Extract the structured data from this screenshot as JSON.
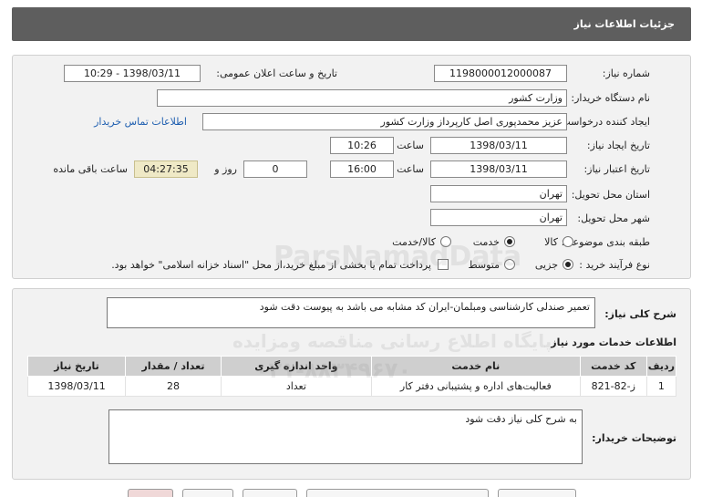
{
  "header": {
    "title": "جزئیات اطلاعات نیاز"
  },
  "form": {
    "need_number_label": "شماره نیاز:",
    "need_number": "1198000012000087",
    "announce_label": "تاریخ و ساعت اعلان عمومی:",
    "announce_value": "1398/03/11 - 10:29",
    "buyer_org_label": "نام دستگاه خریدار:",
    "buyer_org": "وزارت کشور",
    "creator_label": "ایجاد کننده درخواست:",
    "creator": "عزیز محمدپوری اصل کارپرداز وزارت کشور",
    "contact_link": "اطلاعات تماس خریدار",
    "created_date_label": "تاریخ ایجاد نیاز:",
    "created_date": "1398/03/11",
    "hour_label": "ساعت",
    "created_time": "10:26",
    "validity_label": "تاریخ اعتبار نیاز:",
    "validity_date": "1398/03/11",
    "validity_time": "16:00",
    "days_value": "0",
    "days_label": "روز و",
    "remaining_time": "04:27:35",
    "remaining_label": "ساعت باقی مانده",
    "province_label": "استان محل تحویل:",
    "province": "تهران",
    "city_label": "شهر محل تحویل:",
    "city": "تهران",
    "category_label": "طبقه بندی موضوعی:",
    "category_options": [
      "کالا",
      "خدمت",
      "کالا/خدمت"
    ],
    "process_label": "نوع فرآیند خرید :",
    "process_options": [
      "جزیی",
      "متوسط"
    ],
    "payment_note": "پرداخت تمام یا بخشی از مبلغ خرید،از محل \"اسناد خزانه اسلامی\" خواهد بود."
  },
  "summary": {
    "label": "شرح کلی نیاز:",
    "text": "تعمیر صندلی کارشناسی ومبلمان-ایران کد مشابه می باشد به پیوست دقت شود"
  },
  "services": {
    "title": "اطلاعات خدمات مورد نیاز",
    "columns": [
      "ردیف",
      "کد خدمت",
      "نام خدمت",
      "واحد اندازه گیری",
      "تعداد / مقدار",
      "تاریخ نیاز"
    ],
    "rows": [
      [
        "1",
        "ز-82-821",
        "فعالیت‌های اداره و پشتیبانی دفتر کار",
        "تعداد",
        "28",
        "1398/03/11"
      ]
    ]
  },
  "buyer_notes": {
    "label": "توضیحات خریدار:",
    "text": "به شرح کلی نیاز دقت شود"
  },
  "watermark": {
    "brand": "ParsNamadData",
    "line1": "پایگاه اطلاع رسانی مناقصه ومزایده",
    "line2": "۰۲۱-۸۸۳۴۹۶۷۰"
  },
  "colors": {
    "header_bg": "#5e5e5e",
    "panel_bg": "#f2f2f2",
    "link": "#1f5fb0",
    "remaining_bg": "#efe9c6"
  }
}
